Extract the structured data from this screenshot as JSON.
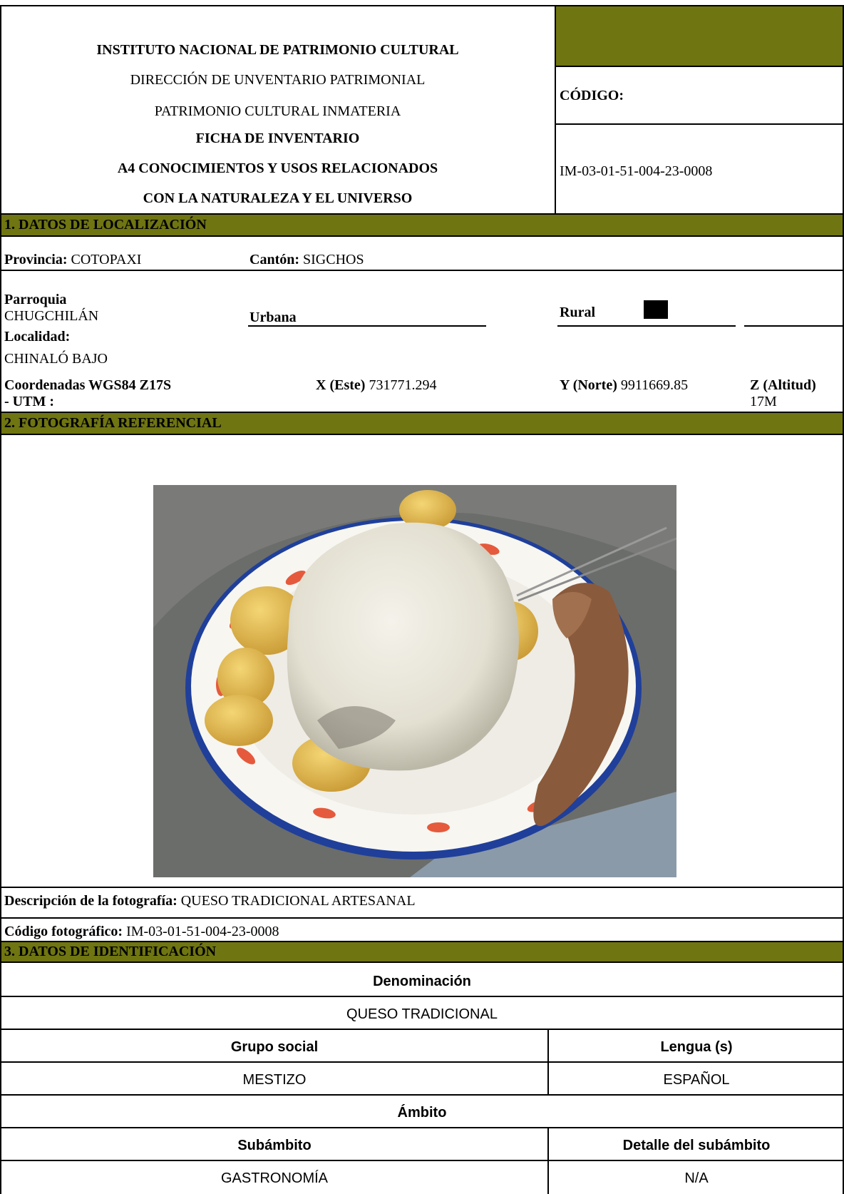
{
  "header": {
    "institute": "INSTITUTO NACIONAL DE PATRIMONIO CULTURAL",
    "direction": "DIRECCIÓN DE UNVENTARIO PATRIMONIAL",
    "heritage": "PATRIMONIO CULTURAL INMATERIA",
    "form_title": "FICHA DE INVENTARIO",
    "category_line1": "A4 CONOCIMIENTOS Y USOS RELACIONADOS",
    "category_line2": "CON LA NATURALEZA Y EL UNIVERSO",
    "code_label": "CÓDIGO:",
    "code_value": "IM-03-01-51-004-23-0008"
  },
  "location": {
    "section_title": "1. DATOS DE LOCALIZACIÓN",
    "province_label": "Provincia:",
    "province_value": "COTOPAXI",
    "canton_label": "Cantón:",
    "canton_value": "SIGCHOS",
    "parish_label": "Parroquia",
    "parish_value": "CHUGCHILÁN",
    "urban_label": "Urbana",
    "rural_label": "Rural",
    "locality_label": "Localidad:",
    "locality_value": "CHINALÓ BAJO",
    "coords_label_line1": "Coordenadas WGS84 Z17S",
    "coords_label_line2": "- UTM :",
    "x_label": "X (Este)",
    "x_value": "731771.294",
    "y_label": "Y (Norte)",
    "y_value": "9911669.85",
    "z_label": "Z (Altitud)",
    "z_value": "17M"
  },
  "photo": {
    "section_title": "2. FOTOGRAFÍA REFERENCIAL",
    "description_label": "Descripción de la fotografía:",
    "description_value": "QUESO TRADICIONAL ARTESANAL",
    "code_label": "Código fotográfico:",
    "code_value": "IM-03-01-51-004-23-0008"
  },
  "identification": {
    "section_title": "3. DATOS DE IDENTIFICACIÓN",
    "denomination_label": "Denominación",
    "denomination_value": "QUESO TRADICIONAL",
    "social_group_label": "Grupo social",
    "social_group_value": "MESTIZO",
    "language_label": "Lengua (s)",
    "language_value": "ESPAÑOL",
    "scope_label": "Ámbito",
    "subscope_label": "Subámbito",
    "subscope_value": "GASTRONOMÍA",
    "subscope_detail_label": "Detalle del subámbito",
    "subscope_detail_value": "N/A"
  },
  "colors": {
    "band": "#6f7511",
    "rule": "#000000"
  }
}
